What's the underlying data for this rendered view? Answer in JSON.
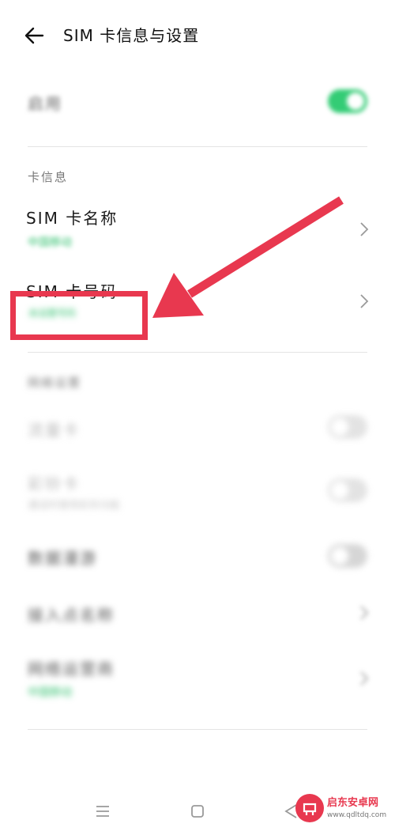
{
  "header": {
    "title": "SIM 卡信息与设置"
  },
  "enable_row": {
    "label": "启用",
    "toggle_on": true
  },
  "card_info": {
    "section_label": "卡信息",
    "sim_name": {
      "label": "SIM 卡名称",
      "value": "中国移动"
    },
    "sim_number": {
      "label": "SIM 卡号码",
      "value": "未设置号码"
    }
  },
  "network": {
    "section_label": "网络设置",
    "row1": {
      "label": "流量卡"
    },
    "row2": {
      "label": "彩铃卡",
      "sub": "通话时使用彩铃功能"
    },
    "row3": {
      "label": "数据漫游"
    },
    "row4": {
      "label": "接入点名称"
    },
    "row5": {
      "label": "网络运营商",
      "sub": "中国移动"
    }
  },
  "annotation": {
    "color": "#e8384f"
  },
  "navbar": {
    "menu_icon": "menu-icon",
    "home_icon": "square-icon",
    "back_icon": "triangle-back-icon"
  },
  "watermark": {
    "brand": "启东安卓网",
    "url": "www.qdltdq.com"
  },
  "colors": {
    "accent": "#33cc75",
    "annotation": "#e8384f"
  }
}
